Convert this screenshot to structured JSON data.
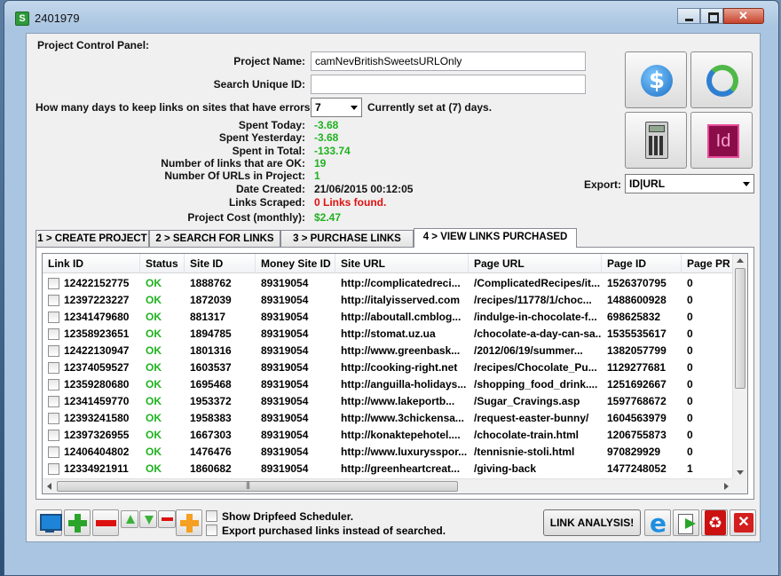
{
  "window": {
    "title": "2401979",
    "app_icon": "S"
  },
  "panel": {
    "section_label": "Project Control Panel:",
    "project_name_label": "Project Name:",
    "project_name_value": "camNevBritishSweetsURLOnly",
    "search_id_label": "Search Unique ID:",
    "search_id_value": "",
    "days_label": "How many days to keep links on sites that have errors:",
    "days_value": "7",
    "days_note": "Currently set at (7) days.",
    "stats": [
      {
        "label": "Spent Today:",
        "value": "-3.68",
        "color": "green"
      },
      {
        "label": "Spent Yesterday:",
        "value": "-3.68",
        "color": "green"
      },
      {
        "label": "Spent in Total:",
        "value": "-133.74",
        "color": "green"
      },
      {
        "label": "Number of links that are OK:",
        "value": "19",
        "color": "green"
      },
      {
        "label": "Number Of URLs in Project:",
        "value": "1",
        "color": "green"
      },
      {
        "label": "Date Created:",
        "value": "21/06/2015 00:12:05",
        "color": "black"
      },
      {
        "label": "Links Scraped:",
        "value": "0 Links found.",
        "color": "red"
      },
      {
        "label": "Project Cost (monthly):",
        "value": "$2.47",
        "color": "green"
      }
    ],
    "export_label": "Export:",
    "export_value": "ID|URL"
  },
  "tabs": [
    {
      "label": "1 > CREATE PROJECT"
    },
    {
      "label": "2 > SEARCH FOR LINKS"
    },
    {
      "label": "3 > PURCHASE LINKS"
    },
    {
      "label": "4 > VIEW LINKS PURCHASED"
    }
  ],
  "grid": {
    "columns": [
      "Link ID",
      "Status",
      "Site ID",
      "Money Site ID",
      "Site URL",
      "Page URL",
      "Page ID",
      "Page PR"
    ],
    "rows": [
      [
        "12422152775",
        "OK",
        "1888762",
        "89319054",
        "http://complicatedreci...",
        "/ComplicatedRecipes/it...",
        "1526370795",
        "0"
      ],
      [
        "12397223227",
        "OK",
        "1872039",
        "89319054",
        "http://italyisserved.com",
        "/recipes/11778/1/choc...",
        "1488600928",
        "0"
      ],
      [
        "12341479680",
        "OK",
        "881317",
        "89319054",
        "http://aboutall.cmblog...",
        "/indulge-in-chocolate-f...",
        "698625832",
        "0"
      ],
      [
        "12358923651",
        "OK",
        "1894785",
        "89319054",
        "http://stomat.uz.ua",
        "/chocolate-a-day-can-sa...",
        "1535535617",
        "0"
      ],
      [
        "12422130947",
        "OK",
        "1801316",
        "89319054",
        "http://www.greenbask...",
        "/2012/06/19/summer...",
        "1382057799",
        "0"
      ],
      [
        "12374059527",
        "OK",
        "1603537",
        "89319054",
        "http://cooking-right.net",
        "/recipes/Chocolate_Pu...",
        "1129277681",
        "0"
      ],
      [
        "12359280680",
        "OK",
        "1695468",
        "89319054",
        "http://anguilla-holidays...",
        "/shopping_food_drink....",
        "1251692667",
        "0"
      ],
      [
        "12341459770",
        "OK",
        "1953372",
        "89319054",
        "http://www.lakeportb...",
        "/Sugar_Cravings.asp",
        "1597768672",
        "0"
      ],
      [
        "12393241580",
        "OK",
        "1958383",
        "89319054",
        "http://www.3chickensa...",
        "/request-easter-bunny/",
        "1604563979",
        "0"
      ],
      [
        "12397326955",
        "OK",
        "1667303",
        "89319054",
        "http://konaktepehotel....",
        "/chocolate-train.html",
        "1206755873",
        "0"
      ],
      [
        "12406404802",
        "OK",
        "1476476",
        "89319054",
        "http://www.luxurysspor...",
        "/tennisnie-stoli.html",
        "970829929",
        "0"
      ],
      [
        "12334921911",
        "OK",
        "1860682",
        "89319054",
        "http://greenheartcreat...",
        "/giving-back",
        "1477248052",
        "1"
      ]
    ]
  },
  "footer": {
    "dripfeed_label": "Show Dripfeed Scheduler.",
    "export_purchased_label": "Export purchased links instead of searched.",
    "link_analysis_label": "LINK ANALYSIS!"
  },
  "colors": {
    "ok_green": "#1fb21f",
    "error_red": "#e01010"
  }
}
